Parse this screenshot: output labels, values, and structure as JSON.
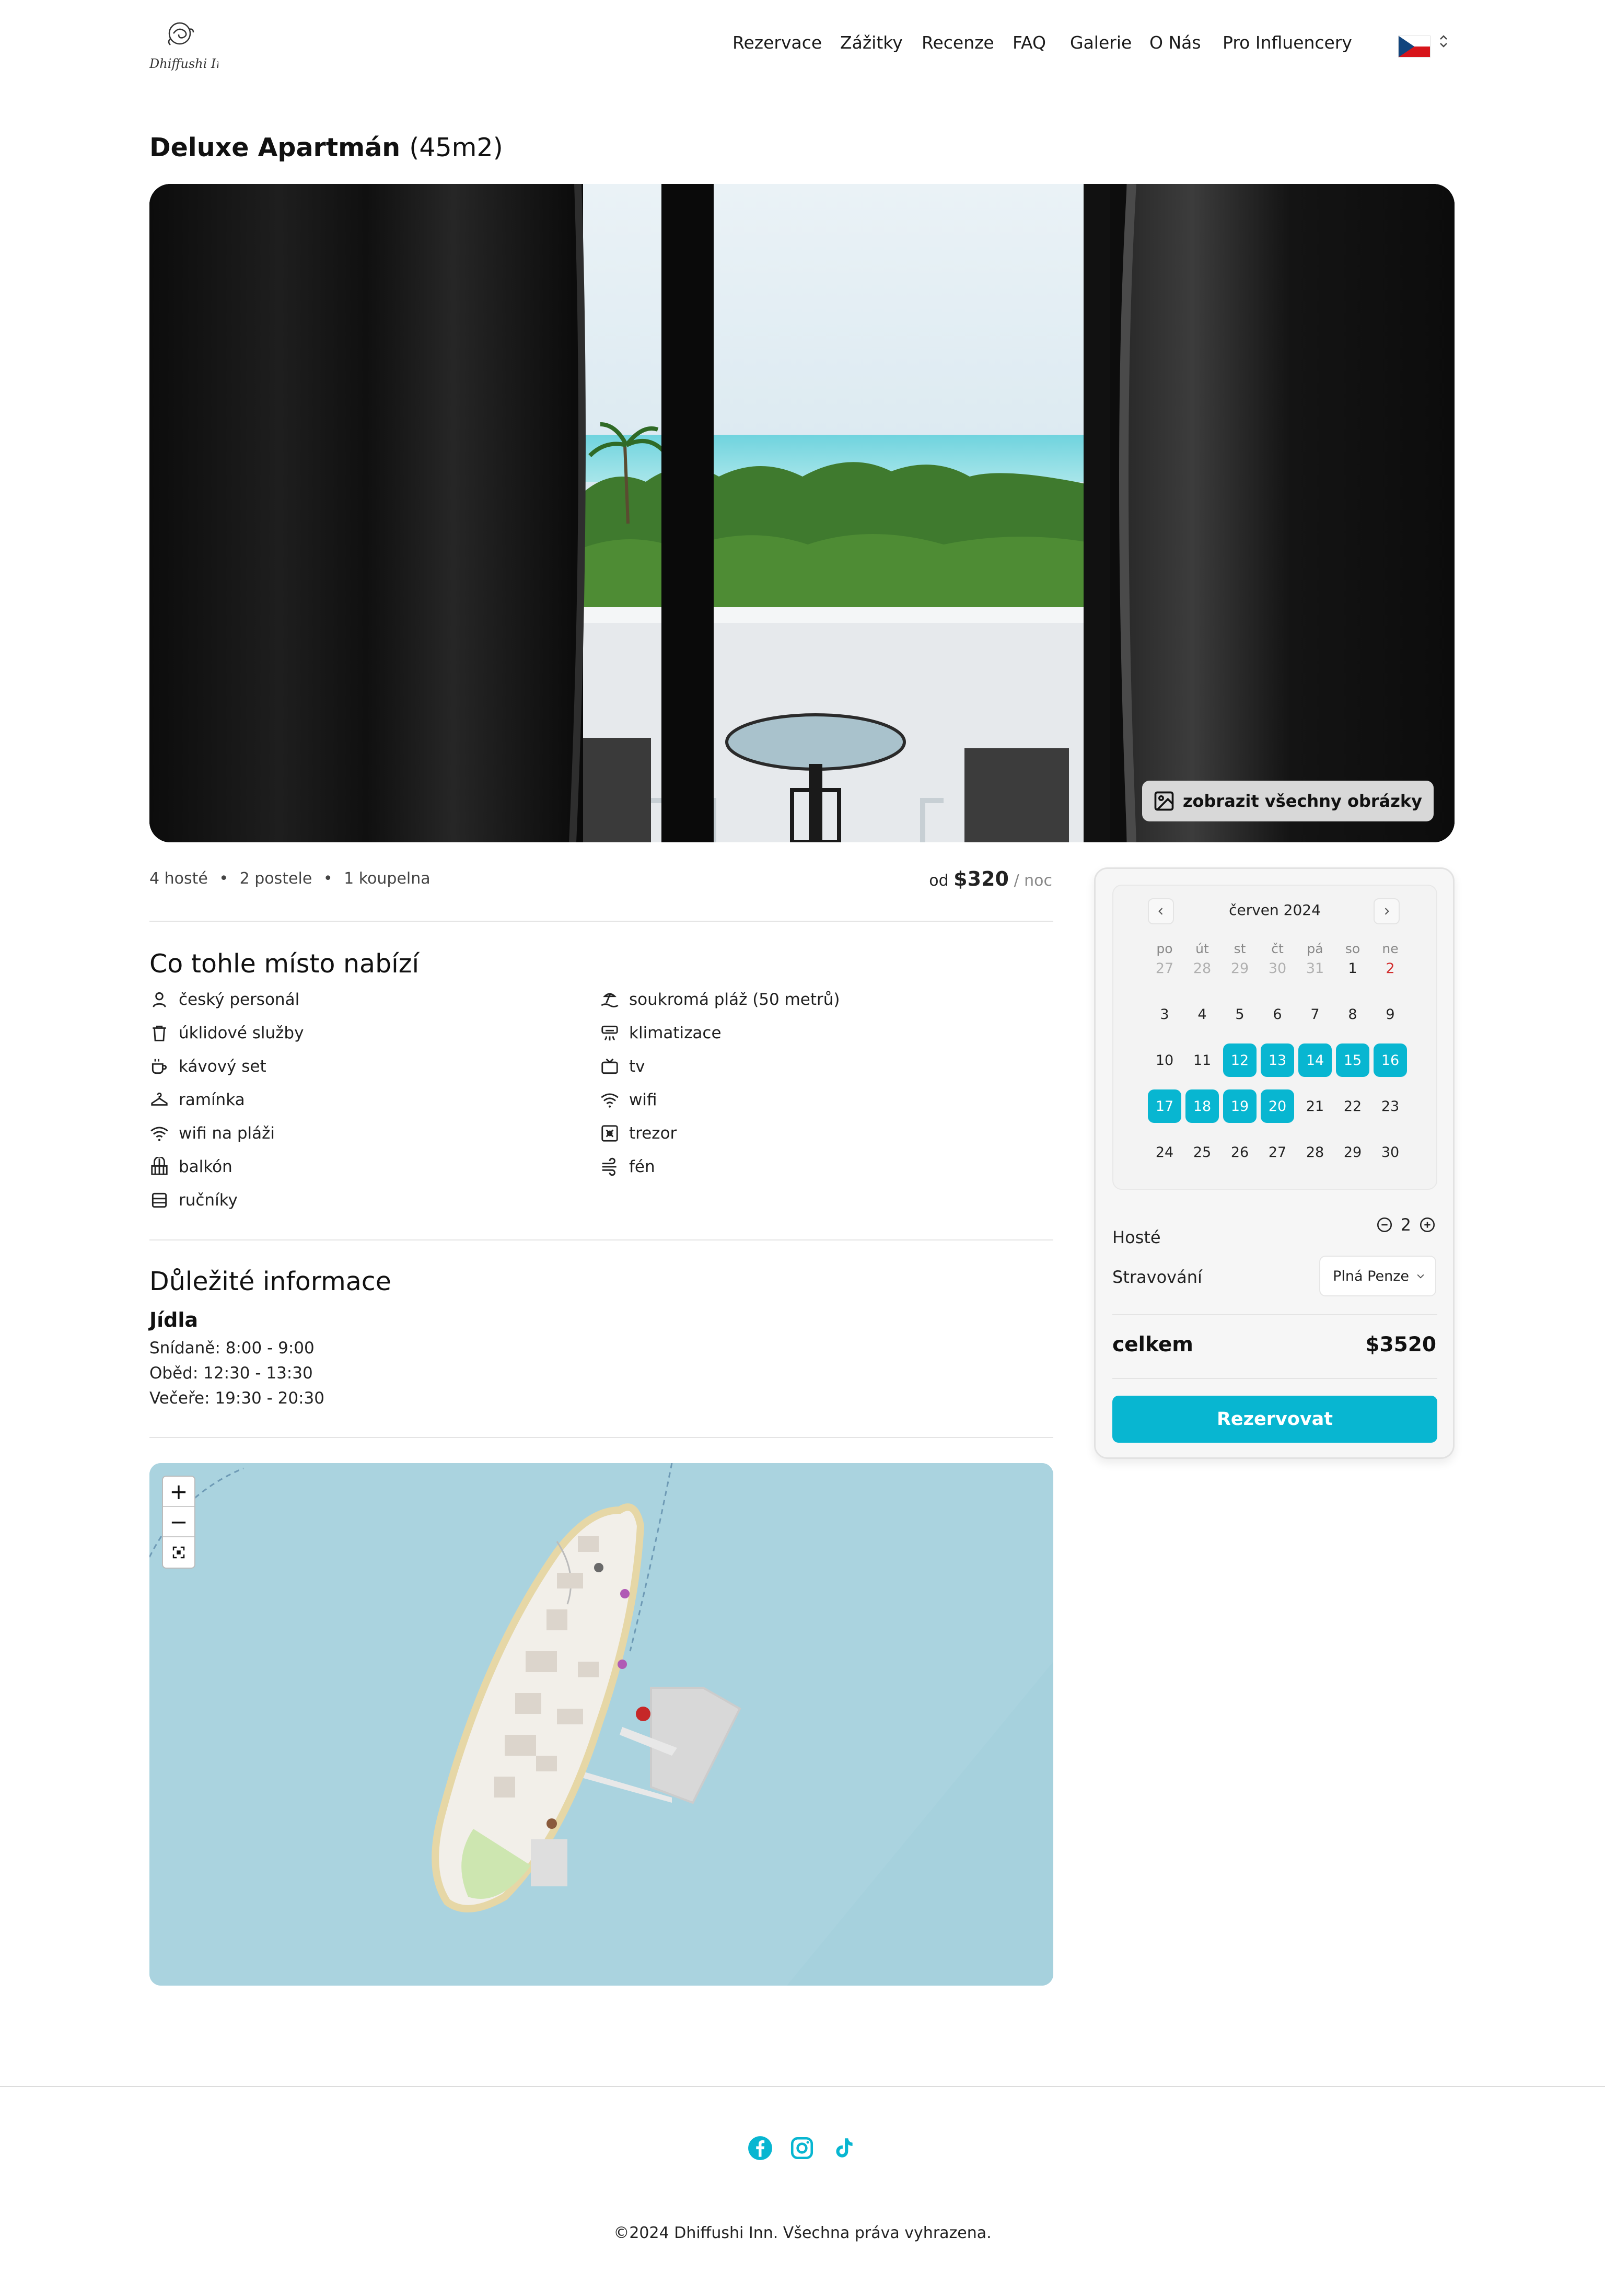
{
  "brand": {
    "logo_text": "Dhiffushi Inn"
  },
  "nav": {
    "items": [
      "Rezervace",
      "Zážitky",
      "Recenze",
      "FAQ",
      "Galerie",
      "O Nás",
      "Pro Influencery"
    ]
  },
  "room": {
    "title": "Deluxe Apartmán",
    "size": "(45m2)",
    "show_all_label": "zobrazit všechny obrázky",
    "meta": {
      "guests": "4 hosté",
      "beds": "2 postele",
      "baths": "1 koupelna",
      "sep": "•"
    },
    "price": {
      "from": "od",
      "amount": "$320",
      "per": "/ noc"
    }
  },
  "amenities": {
    "heading": "Co tohle místo nabízí",
    "left": [
      {
        "label": "český personál",
        "icon": "person-icon"
      },
      {
        "label": "úklidové služby",
        "icon": "trash-icon"
      },
      {
        "label": "kávový set",
        "icon": "coffee-icon"
      },
      {
        "label": "ramínka",
        "icon": "hanger-icon"
      },
      {
        "label": "wifi na pláži",
        "icon": "wifi-icon"
      },
      {
        "label": "balkón",
        "icon": "balcony-icon"
      },
      {
        "label": "ručníky",
        "icon": "towel-icon"
      }
    ],
    "right": [
      {
        "label": "soukromá pláž (50 metrů)",
        "icon": "beach-icon"
      },
      {
        "label": "klimatizace",
        "icon": "air-conditioner-icon"
      },
      {
        "label": "tv",
        "icon": "tv-icon"
      },
      {
        "label": "wifi",
        "icon": "wifi-icon"
      },
      {
        "label": "trezor",
        "icon": "safe-icon"
      },
      {
        "label": "fén",
        "icon": "wind-icon"
      }
    ]
  },
  "info": {
    "heading": "Důležité informace",
    "subheading": "Jídla",
    "lines": [
      "Snídaně: 8:00 - 9:00",
      "Oběd: 12:30 - 13:30",
      "Večeře: 19:30 - 20:30"
    ]
  },
  "map": {
    "zoom_in": "+",
    "zoom_out": "−"
  },
  "booking": {
    "calendar": {
      "month": "červen 2024",
      "weekdays": [
        "po",
        "út",
        "st",
        "čt",
        "pá",
        "so",
        "ne"
      ],
      "weeks": [
        [
          "27",
          "28",
          "29",
          "30",
          "31",
          "1",
          "2"
        ],
        [
          "3",
          "4",
          "5",
          "6",
          "7",
          "8",
          "9"
        ],
        [
          "10",
          "11",
          "12",
          "13",
          "14",
          "15",
          "16"
        ],
        [
          "17",
          "18",
          "19",
          "20",
          "21",
          "22",
          "23"
        ],
        [
          "24",
          "25",
          "26",
          "27",
          "28",
          "29",
          "30"
        ]
      ],
      "selected_days": [
        "12",
        "13",
        "14",
        "15",
        "16",
        "17",
        "18",
        "19",
        "20"
      ]
    },
    "guests_label": "Hosté",
    "guests_value": "2",
    "meal_label": "Stravování",
    "meal_value": "Plná Penze",
    "total_label": "celkem",
    "total_value": "$3520",
    "book_label": "Rezervovat"
  },
  "colors": {
    "accent": "#08b6d1",
    "sunday": "#d23030",
    "map_water": "#aad3df"
  },
  "footer": {
    "social": [
      "facebook-icon",
      "instagram-icon",
      "tiktok-icon"
    ],
    "copyright": "©2024 Dhiffushi Inn. Všechna práva vyhrazena."
  }
}
